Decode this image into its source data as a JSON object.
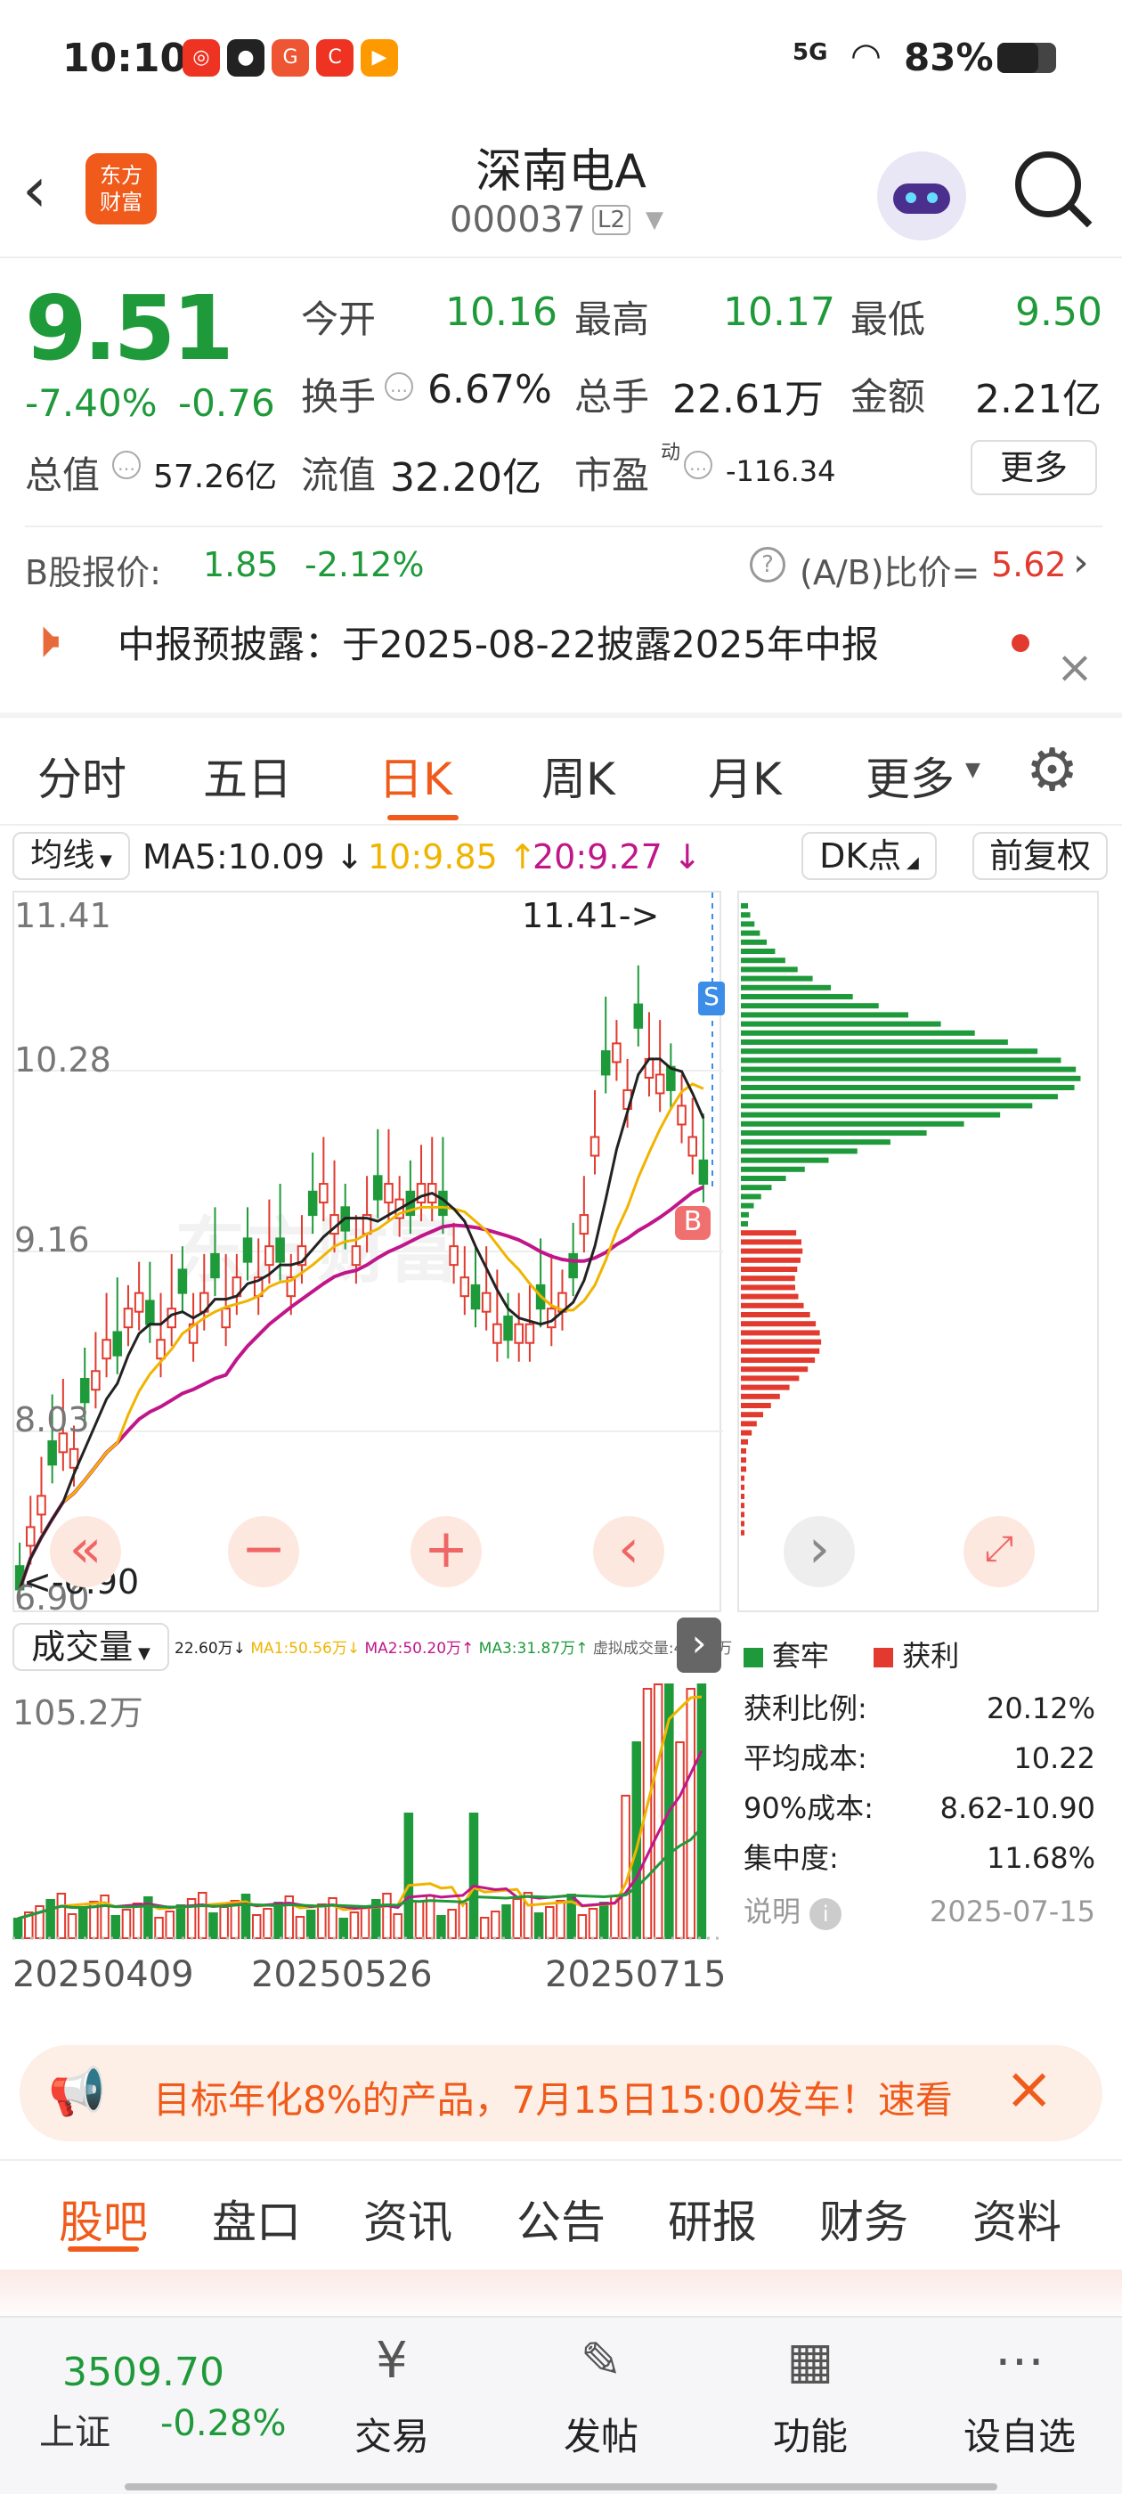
{
  "status": {
    "time": "10:10",
    "network": "5G",
    "battery": "83%"
  },
  "header": {
    "logo_line1": "东方",
    "logo_line2": "财富",
    "stock_name": "深南电A",
    "stock_code": "000037",
    "level": "L2"
  },
  "quote": {
    "price": "9.51",
    "change_pct": "-7.40%",
    "change": "-0.76",
    "open_label": "今开",
    "open": "10.16",
    "high_label": "最高",
    "high": "10.17",
    "low_label": "最低",
    "low": "9.50",
    "turnover_label": "换手",
    "turnover": "6.67%",
    "vol_label": "总手",
    "vol": "22.61万",
    "amount_label": "金额",
    "amount": "2.21亿",
    "mcap_label": "总值",
    "mcap": "57.26亿",
    "float_label": "流值",
    "float": "32.20亿",
    "pe_label": "市盈",
    "pe_sup": "动",
    "pe": "-116.34",
    "more": "更多"
  },
  "bshare": {
    "label": "B股报价:",
    "price": "1.85",
    "pct": "-2.12%",
    "ratio_label": "(A/B)比价=",
    "ratio": "5.62"
  },
  "notice": {
    "text": "中报预披露：于2025-08-22披露2025年中报"
  },
  "period_tabs": [
    "分时",
    "五日",
    "日K",
    "周K",
    "月K",
    "更多"
  ],
  "active_tab": "日K",
  "ma_bar": {
    "type": "均线",
    "ma5": "MA5:10.09",
    "ma10": "10:9.85",
    "ma20": "20:9.27",
    "dk": "DK点",
    "fq": "前复权"
  },
  "kline": {
    "y_labels": [
      "11.41",
      "10.28",
      "9.16",
      "8.03",
      "6.90"
    ],
    "max_tag": "11.41->",
    "min_tag": "<-6.90",
    "s_tag": "S",
    "b_tag": "B",
    "watermark": "东方财富"
  },
  "colors": {
    "up": "#e23a2e",
    "down": "#1f9a3a",
    "ma5": "#222222",
    "ma10": "#f0b400",
    "ma20": "#c0168a"
  },
  "volume": {
    "label": "成交量",
    "vol": "22.60万",
    "ma1": "MA1:50.56万",
    "ma2": "MA2:50.20万",
    "ma3": "MA3:31.87万",
    "virtual": "虚拟成交量:45.65万",
    "y_top": "105.2万",
    "dates": [
      "20250409",
      "20250526",
      "20250715"
    ]
  },
  "chip": {
    "legend_trap": "套牢",
    "legend_profit": "获利",
    "rows": [
      {
        "k": "获利比例:",
        "v": "20.12%"
      },
      {
        "k": "平均成本:",
        "v": "10.22"
      },
      {
        "k": "90%成本:",
        "v": "8.62-10.90"
      },
      {
        "k": "集中度:",
        "v": "11.68%"
      }
    ],
    "note": "说明",
    "date": "2025-07-15"
  },
  "ad": {
    "text": "目标年化8%的产品，7月15日15:00发车！速看"
  },
  "sub_tabs": [
    "股吧",
    "盘口",
    "资讯",
    "公告",
    "研报",
    "财务",
    "资料"
  ],
  "bottom": {
    "index_value": "3509.70",
    "index_name": "上证",
    "index_pct": "-0.28%",
    "nav": [
      "交易",
      "发帖",
      "功能",
      "设自选"
    ]
  }
}
